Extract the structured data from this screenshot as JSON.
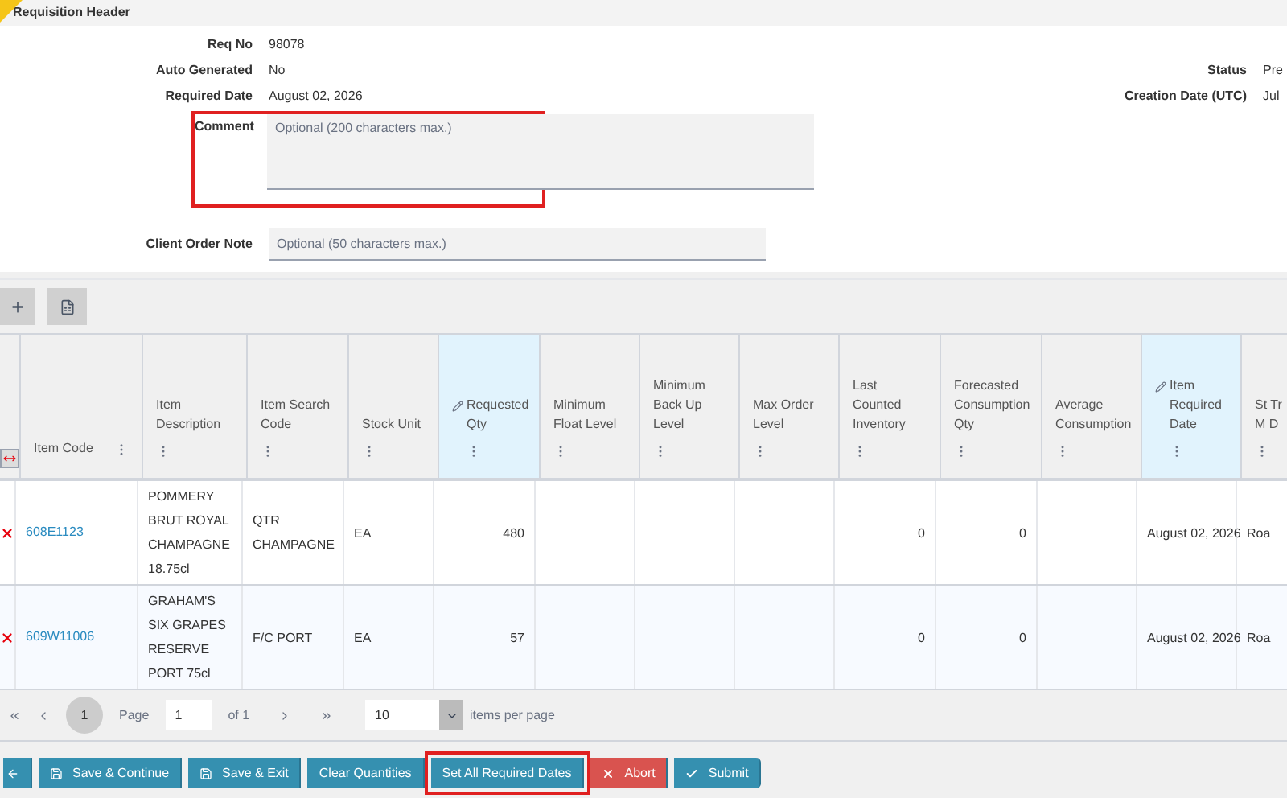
{
  "section_title": "Requisition Header",
  "fields_left": [
    {
      "label": "Req No",
      "value": "98078"
    },
    {
      "label": "Auto Generated",
      "value": "No"
    },
    {
      "label": "Required Date",
      "value": "August 02, 2026"
    }
  ],
  "fields_right": [
    {
      "label": "Status",
      "value": "Pre"
    },
    {
      "label": "Creation Date (UTC)",
      "value": "Jul"
    }
  ],
  "comment": {
    "label": "Comment",
    "placeholder": "Optional (200 characters max.)",
    "highlighted": true
  },
  "client_order_note": {
    "label": "Client Order Note",
    "placeholder": "Optional (50 characters max.)"
  },
  "table": {
    "columns": [
      {
        "label": "Item Code",
        "editable": false
      },
      {
        "label": "Item Description",
        "editable": false
      },
      {
        "label": "Item Search Code",
        "editable": false
      },
      {
        "label": "Stock Unit",
        "editable": false
      },
      {
        "label": "Requested Qty",
        "editable": true
      },
      {
        "label": "Minimum Float Level",
        "editable": false
      },
      {
        "label": "Minimum Back Up Level",
        "editable": false
      },
      {
        "label": "Max Order Level",
        "editable": false
      },
      {
        "label": "Last Counted Inventory",
        "editable": false
      },
      {
        "label": "Forecasted Consumption Qty",
        "editable": false
      },
      {
        "label": "Average Consumption",
        "editable": false
      },
      {
        "label": "Item Required Date",
        "editable": true
      },
      {
        "label": "St Tr M D",
        "editable": false
      }
    ],
    "rows": [
      {
        "cells": [
          "608E1123",
          "POMMERY BRUT ROYAL CHAMPAGNE 18.75cl",
          "QTR CHAMPAGNE",
          "EA",
          "480",
          "",
          "",
          "",
          "0",
          "0",
          "",
          "August 02, 2026",
          "Roa"
        ]
      },
      {
        "cells": [
          "609W11006",
          "GRAHAM'S SIX GRAPES RESERVE PORT 75cl",
          "F/C PORT",
          "EA",
          "57",
          "",
          "",
          "",
          "0",
          "0",
          "",
          "August 02, 2026",
          "Roa"
        ]
      }
    ]
  },
  "pager": {
    "current_page": "1",
    "page_label": "Page",
    "page_input": "1",
    "of_label": "of 1",
    "page_size": "10",
    "page_size_label": "items per page"
  },
  "actions": [
    {
      "kind": "back",
      "highlighted": false
    },
    {
      "label": "Save & Continue",
      "kind": "save",
      "highlighted": false
    },
    {
      "label": "Save & Exit",
      "kind": "save",
      "highlighted": false
    },
    {
      "label": "Clear Quantities",
      "kind": "plain",
      "highlighted": false
    },
    {
      "label": "Set All Required Dates",
      "kind": "plain",
      "highlighted": true
    },
    {
      "label": "Abort",
      "kind": "danger",
      "highlighted": false
    },
    {
      "label": "Submit",
      "kind": "submit",
      "highlighted": false
    }
  ]
}
